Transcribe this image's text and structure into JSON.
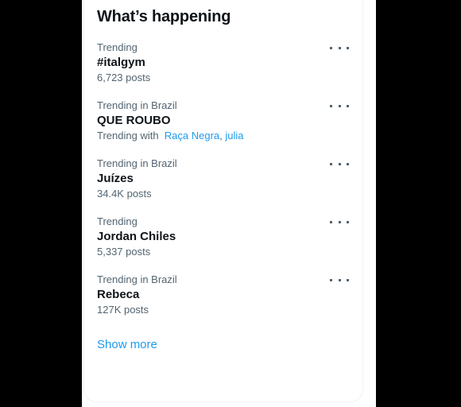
{
  "card": {
    "title": "What’s happening",
    "show_more_label": "Show more",
    "accent_color": "#1d9bf0",
    "primary_text_color": "#0f1419",
    "secondary_text_color": "#536471",
    "background_color": "#ffffff",
    "page_background_color": "#000000",
    "menu_icon_name": "more-options-icon"
  },
  "trends": [
    {
      "meta": "Trending",
      "name": "#italgym",
      "count": "6,723 posts",
      "with_prefix": null,
      "with_links": []
    },
    {
      "meta": "Trending in Brazil",
      "name": "QUE ROUBO",
      "count": null,
      "with_prefix": "Trending with",
      "with_links": [
        "Raça Negra",
        "julia"
      ],
      "with_separator": ", "
    },
    {
      "meta": "Trending in Brazil",
      "name": "Juízes",
      "count": "34.4K posts",
      "with_prefix": null,
      "with_links": []
    },
    {
      "meta": "Trending",
      "name": "Jordan Chiles",
      "count": "5,337 posts",
      "with_prefix": null,
      "with_links": []
    },
    {
      "meta": "Trending in Brazil",
      "name": "Rebeca",
      "count": "127K posts",
      "with_prefix": null,
      "with_links": []
    }
  ]
}
